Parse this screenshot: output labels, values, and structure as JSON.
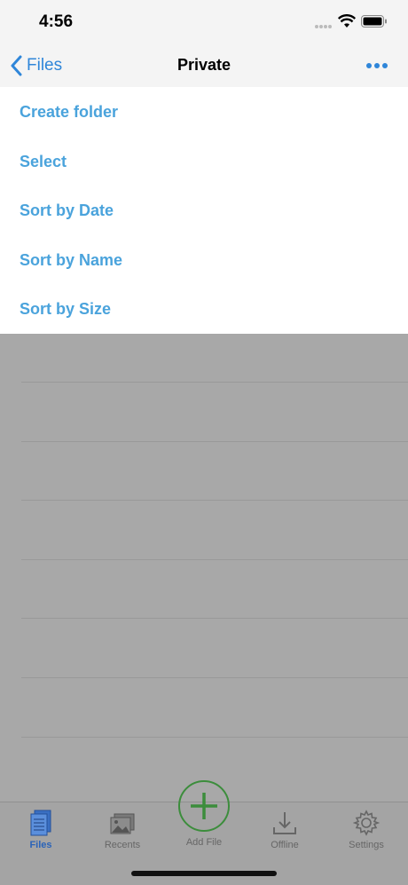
{
  "status_bar": {
    "time": "4:56"
  },
  "nav": {
    "back_label": "Files",
    "title": "Private"
  },
  "menu": {
    "items": [
      {
        "label": "Create folder"
      },
      {
        "label": "Select"
      },
      {
        "label": "Sort by Date"
      },
      {
        "label": "Sort by Name"
      },
      {
        "label": "Sort by Size"
      }
    ]
  },
  "tab_bar": {
    "tabs": [
      {
        "label": "Files",
        "icon": "files-icon",
        "active": true
      },
      {
        "label": "Recents",
        "icon": "recents-icon"
      },
      {
        "label": "Add File",
        "icon": "plus-icon"
      },
      {
        "label": "Offline",
        "icon": "download-icon"
      },
      {
        "label": "Settings",
        "icon": "gear-icon"
      }
    ]
  },
  "colors": {
    "accent": "#2f86d9",
    "menu_text": "#4aa3dc",
    "add_green": "#3c8d3c",
    "overlay": "#a8a8a8"
  }
}
